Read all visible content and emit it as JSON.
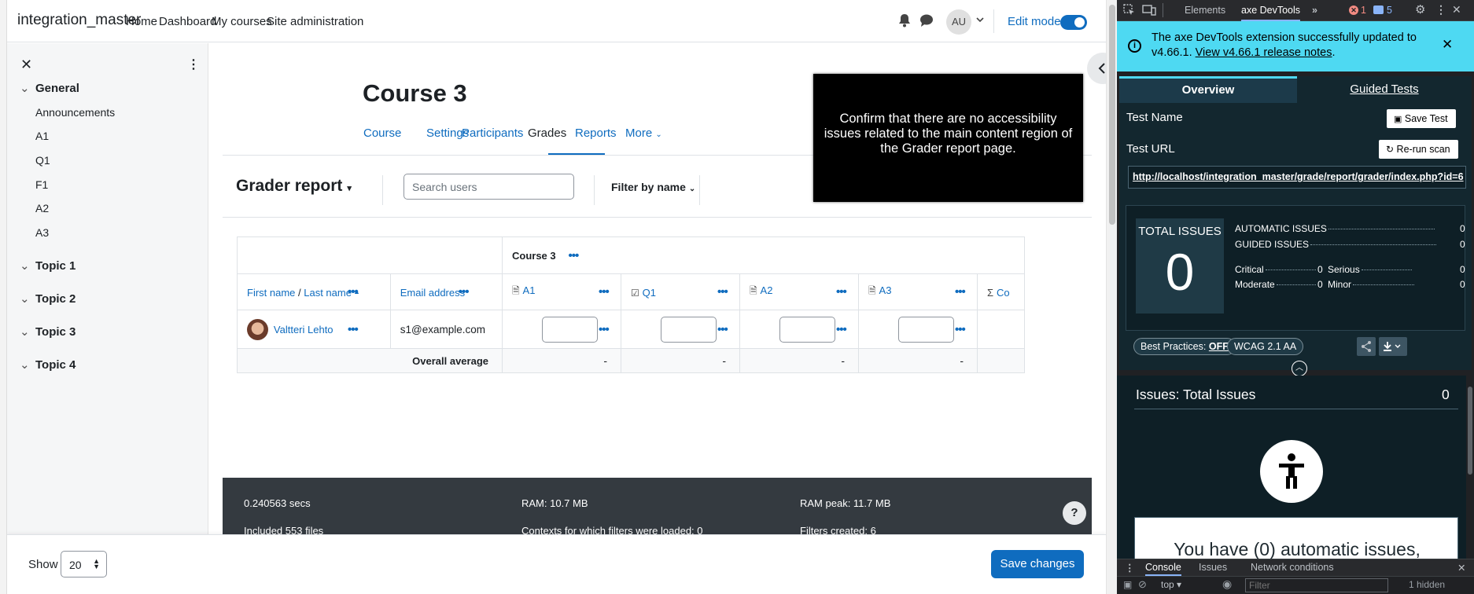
{
  "navbar": {
    "brand": "integration_master",
    "links": [
      "Home",
      "Dashboard",
      "My courses",
      "Site administration"
    ],
    "avatar_initials": "AU",
    "edit_mode_label": "Edit mode",
    "edit_mode_on": true
  },
  "course_index": {
    "sections": [
      {
        "title": "General",
        "activities": [
          "Announcements",
          "A1",
          "Q1",
          "F1",
          "A2",
          "A3"
        ]
      },
      {
        "title": "Topic 1",
        "activities": []
      },
      {
        "title": "Topic 2",
        "activities": []
      },
      {
        "title": "Topic 3",
        "activities": []
      },
      {
        "title": "Topic 4",
        "activities": []
      }
    ]
  },
  "course": {
    "title": "Course 3",
    "tabs": [
      "Course",
      "Settings",
      "Participants",
      "Grades",
      "Reports",
      "More"
    ],
    "active_tab": "Grades"
  },
  "grader": {
    "title": "Grader report",
    "search_placeholder": "Search users",
    "filter_label": "Filter by name"
  },
  "tooltip_text": "Confirm that there are no accessibility issues related to the main content region of the Grader report page.",
  "table": {
    "category_header": "Course 3",
    "name_header_first": "First name",
    "name_header_sep": " / ",
    "name_header_last": "Last name",
    "email_header": "Email address",
    "items": [
      "A1",
      "Q1",
      "A2",
      "A3"
    ],
    "last_col_partial": "Co",
    "students": [
      {
        "name": "Valtteri Lehto",
        "email": "s1@example.com"
      }
    ],
    "overall_average_label": "Overall average",
    "averages": [
      "-",
      "-",
      "-",
      "-"
    ]
  },
  "perf": {
    "items": [
      "0.240563 secs",
      "RAM: 10.7 MB",
      "RAM peak: 11.7 MB",
      "Included 553 files",
      "Contexts for which filters were loaded: 0",
      "Filters created: 6"
    ]
  },
  "footer": {
    "show_label": "Show",
    "show_value": "20",
    "save_label": "Save changes",
    "help_label": "?"
  },
  "devtools": {
    "tabs": [
      "Elements",
      "axe DevTools"
    ],
    "errors_count": "1",
    "messages_count": "5",
    "banner_text": "The axe DevTools extension successfully updated to v4.66.1.",
    "banner_link": "View v4.66.1 release notes",
    "banner_link_suffix": ".",
    "axe_tabs": [
      "Overview",
      "Guided Tests"
    ],
    "test_name_label": "Test Name",
    "save_test_label": "Save Test",
    "test_url_label": "Test URL",
    "rerun_label": "Re-run scan",
    "test_url": "http://localhost/integration_master/grade/report/grader/index.php?id=6",
    "total_issues_label": "TOTAL ISSUES",
    "total_issues": "0",
    "automatic_label": "AUTOMATIC ISSUES",
    "automatic_count": "0",
    "guided_label": "GUIDED ISSUES",
    "guided_count": "0",
    "critical_label": "Critical",
    "critical_count": "0",
    "serious_label": "Serious",
    "serious_count": "0",
    "moderate_label": "Moderate",
    "moderate_count": "0",
    "minor_label": "Minor",
    "minor_count": "0",
    "best_practices_label": "Best Practices:",
    "best_practices_value": "OFF",
    "wcag_label": "WCAG 2.1 AA",
    "issues_title": "Issues: Total Issues",
    "issues_count": "0",
    "auto_message": "You have (0) automatic issues,",
    "drawer_tabs": [
      "Console",
      "Issues",
      "Network conditions"
    ],
    "context": "top",
    "filter_placeholder": "Filter",
    "hidden_label": "1 hidden"
  }
}
